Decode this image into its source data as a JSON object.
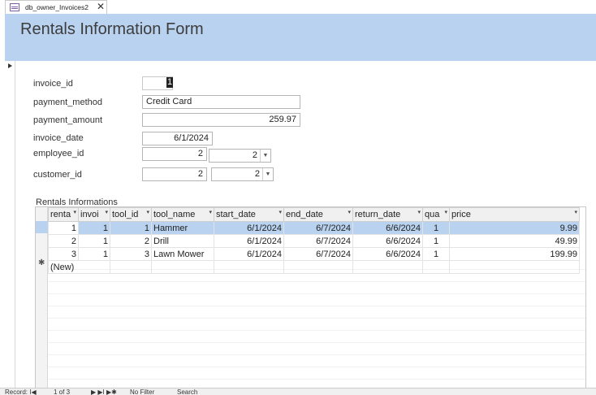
{
  "tab": {
    "label": "db_owner_Invoices2",
    "close": "✕",
    "icon": "form-icon"
  },
  "form": {
    "title": "Rentals Information Form"
  },
  "fields": {
    "invoice_id": {
      "label": "invoice_id",
      "value": "1"
    },
    "payment_method": {
      "label": "payment_method",
      "value": "Credit Card"
    },
    "payment_amount": {
      "label": "payment_amount",
      "value": "259.97"
    },
    "invoice_date": {
      "label": "invoice_date",
      "value": "6/1/2024"
    },
    "employee_id": {
      "label": "employee_id",
      "value": "2",
      "combo_value": "2"
    },
    "customer_id": {
      "label": "customer_id",
      "value": "2",
      "combo_value": "2"
    }
  },
  "subform": {
    "caption": "Rentals Informations",
    "columns": [
      "renta",
      "invoi",
      "tool_id",
      "tool_name",
      "start_date",
      "end_date",
      "return_date",
      "qua",
      "price"
    ],
    "rows": [
      [
        "1",
        "1",
        "1",
        "Hammer",
        "6/1/2024",
        "6/7/2024",
        "6/6/2024",
        "1",
        "9.99"
      ],
      [
        "2",
        "1",
        "2",
        "Drill",
        "6/1/2024",
        "6/7/2024",
        "6/6/2024",
        "1",
        "49.99"
      ],
      [
        "3",
        "1",
        "3",
        "Lawn Mower",
        "6/1/2024",
        "6/7/2024",
        "6/6/2024",
        "1",
        "199.99"
      ]
    ],
    "new_row_label": "(New)",
    "new_row_icon": "✱"
  },
  "status": {
    "record": "Record: I◀",
    "position": "1 of 3",
    "nav": "▶ ▶I ▶✱",
    "filter": "No Filter",
    "search": "Search"
  }
}
